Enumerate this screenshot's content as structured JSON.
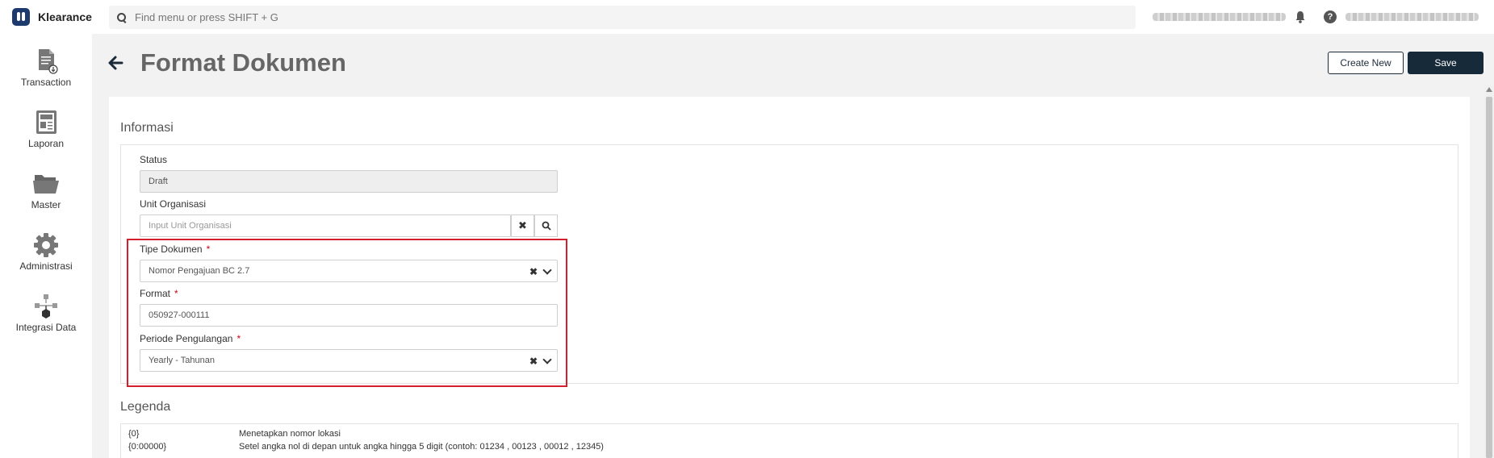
{
  "brand": {
    "name": "Klearance"
  },
  "search": {
    "placeholder": "Find menu or press SHIFT + G"
  },
  "sidebar": {
    "items": [
      {
        "label": "Transaction",
        "icon": "document-download-icon"
      },
      {
        "label": "Laporan",
        "icon": "report-newspaper-icon"
      },
      {
        "label": "Master",
        "icon": "folder-icon"
      },
      {
        "label": "Administrasi",
        "icon": "gear-icon"
      },
      {
        "label": "Integrasi Data",
        "icon": "network-icon"
      }
    ]
  },
  "page": {
    "title": "Format Dokumen"
  },
  "toolbar": {
    "create_label": "Create New",
    "save_label": "Save"
  },
  "informasi": {
    "title": "Informasi",
    "status": {
      "label": "Status",
      "value": "Draft"
    },
    "unit_organisasi": {
      "label": "Unit Organisasi",
      "placeholder": "Input Unit Organisasi"
    },
    "tipe_dokumen": {
      "label": "Tipe Dokumen",
      "value": "Nomor Pengajuan BC 2.7"
    },
    "format": {
      "label": "Format",
      "value": "050927-000111"
    },
    "periode": {
      "label": "Periode Pengulangan",
      "value": "Yearly - Tahunan"
    },
    "required_mark": "*"
  },
  "legenda": {
    "title": "Legenda",
    "rows": [
      {
        "code": "{0}",
        "desc": "Menetapkan nomor lokasi"
      },
      {
        "code": "{0:00000}",
        "desc": "Setel angka nol di depan untuk angka hingga 5 digit (contoh: 01234 , 00123 , 00012 , 12345)"
      }
    ]
  },
  "colors": {
    "accent_dark": "#172a3a",
    "highlight_red": "#d4202c",
    "required_red": "#d0021b"
  }
}
